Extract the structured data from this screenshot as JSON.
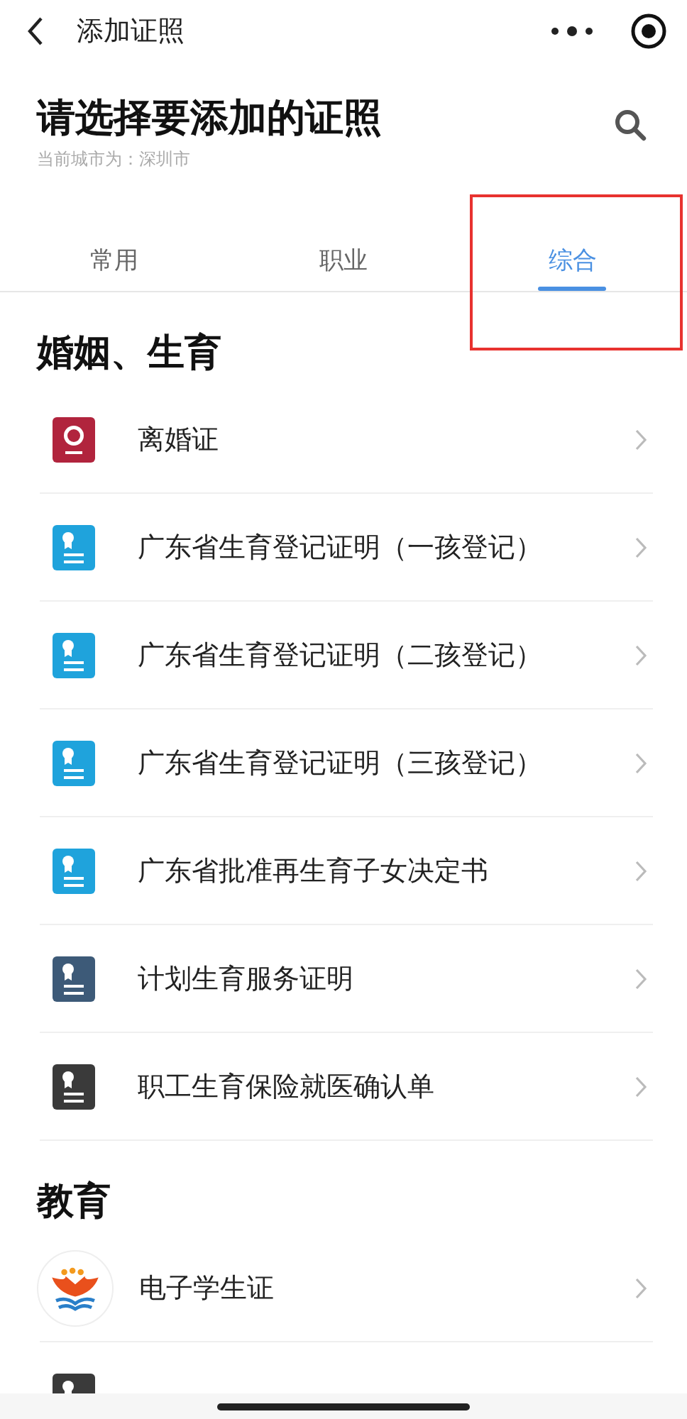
{
  "nav": {
    "title": "添加证照"
  },
  "header": {
    "title": "请选择要添加的证照",
    "subtitle": "当前城市为：深圳市"
  },
  "tabs": [
    {
      "label": "常用",
      "selected": false
    },
    {
      "label": "职业",
      "selected": false
    },
    {
      "label": "综合",
      "selected": true
    }
  ],
  "annotation": {
    "kind": "frame",
    "color": "#e8322f"
  },
  "sections": [
    {
      "title": "婚姻、生育",
      "items": [
        {
          "kind": "seal",
          "color": "#b1243d",
          "label": "离婚证"
        },
        {
          "kind": "certificate",
          "color": "#1fa3dc",
          "label": "广东省生育登记证明（一孩登记）"
        },
        {
          "kind": "certificate",
          "color": "#1fa3dc",
          "label": "广东省生育登记证明（二孩登记）"
        },
        {
          "kind": "certificate",
          "color": "#1fa3dc",
          "label": "广东省生育登记证明（三孩登记）"
        },
        {
          "kind": "certificate",
          "color": "#1fa3dc",
          "label": "广东省批准再生育子女决定书"
        },
        {
          "kind": "certificate",
          "color": "#3d5a78",
          "label": "计划生育服务证明"
        },
        {
          "kind": "certificate",
          "color": "#3a3a3a",
          "label": "职工生育保险就医确认单"
        }
      ]
    },
    {
      "title": "教育",
      "items": [
        {
          "kind": "emblem",
          "label": "电子学生证"
        },
        {
          "kind": "certificate",
          "color": "#3a3a3a"
        }
      ]
    }
  ]
}
